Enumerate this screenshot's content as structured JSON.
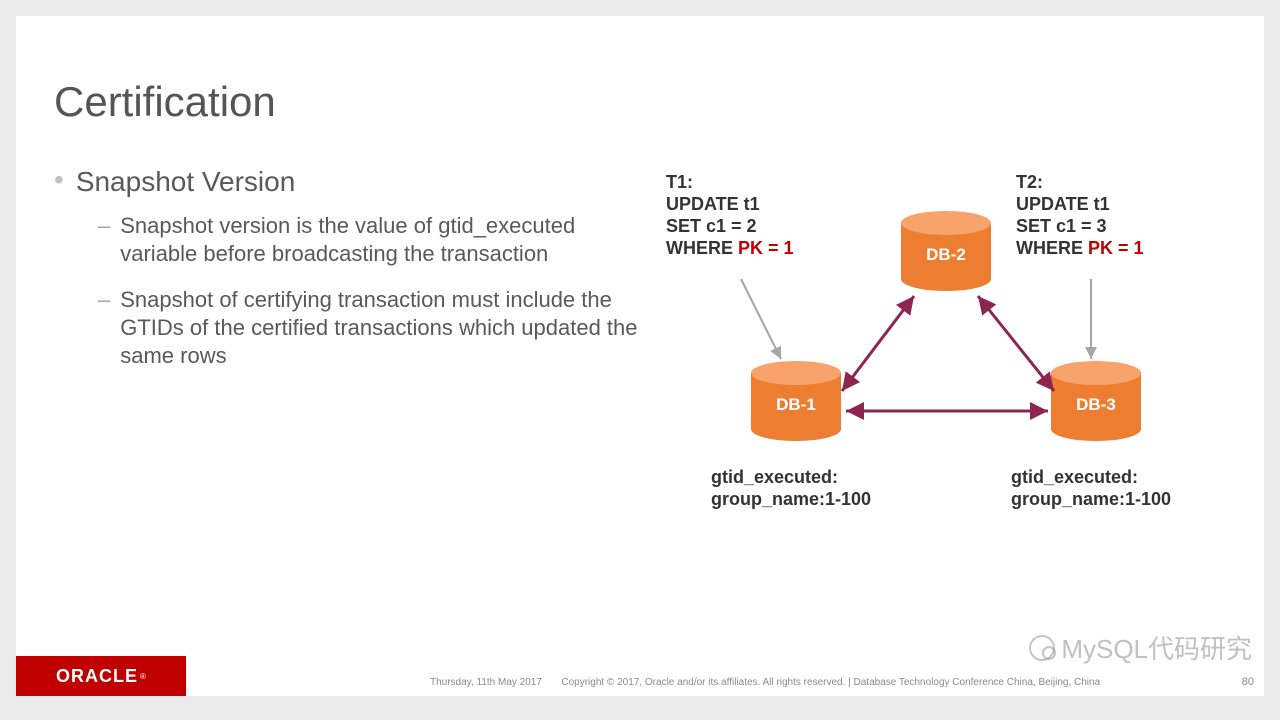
{
  "title": "Certification",
  "bullets": {
    "lvl1": "Snapshot Version",
    "l2a": "Snapshot version is the value of gtid_executed variable before broadcasting the transaction",
    "l2b": "Snapshot of certifying transaction must include the GTIDs of the certified transactions which updated the same rows"
  },
  "t1": {
    "head": "T1:",
    "l1": "UPDATE t1",
    "l2": "SET c1 = 2",
    "l3": "WHERE ",
    "pk": "PK = 1"
  },
  "t2": {
    "head": "T2:",
    "l1": "UPDATE t1",
    "l2": "SET c1 = 3",
    "l3": "WHERE ",
    "pk": "PK = 1"
  },
  "db": {
    "d1": "DB-1",
    "d2": "DB-2",
    "d3": "DB-3"
  },
  "gtid1": {
    "a": "gtid_executed:",
    "b": "group_name:1-100"
  },
  "gtid3": {
    "a": "gtid_executed:",
    "b": "group_name:1-100"
  },
  "footer": {
    "date": "Thursday, 11th May 2017",
    "copy": "Copyright © 2017, Oracle and/or its affiliates. All rights reserved.   |   Database Technology Conference China, Beijing, China",
    "page": "80",
    "logo": "ORACLE"
  },
  "watermark": "MySQL代码研究"
}
